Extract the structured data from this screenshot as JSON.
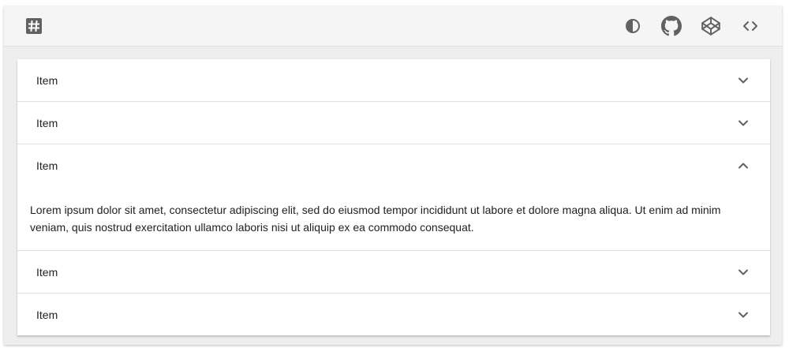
{
  "toolbar": {
    "logo_icon": "hashtag-square-icon",
    "actions": [
      {
        "icon": "contrast-icon"
      },
      {
        "icon": "github-icon"
      },
      {
        "icon": "codepen-icon"
      },
      {
        "icon": "code-brackets-icon"
      }
    ]
  },
  "accordion": {
    "panels": [
      {
        "title": "Item",
        "expanded": false,
        "icon": "chevron-down-icon"
      },
      {
        "title": "Item",
        "expanded": false,
        "icon": "chevron-down-icon"
      },
      {
        "title": "Item",
        "expanded": true,
        "icon": "chevron-up-icon",
        "content": "Lorem ipsum dolor sit amet, consectetur adipiscing elit, sed do eiusmod tempor incididunt ut labore et dolore magna aliqua. Ut enim ad minim veniam, quis nostrud exercitation ullamco laboris nisi ut aliquip ex ea commodo consequat."
      },
      {
        "title": "Item",
        "expanded": false,
        "icon": "chevron-down-icon"
      },
      {
        "title": "Item",
        "expanded": false,
        "icon": "chevron-down-icon"
      }
    ]
  },
  "colors": {
    "toolbar_bg": "#f5f5f5",
    "page_bg": "#eeeeee",
    "panel_bg": "#ffffff",
    "icon": "#616161",
    "text": "#212121"
  }
}
